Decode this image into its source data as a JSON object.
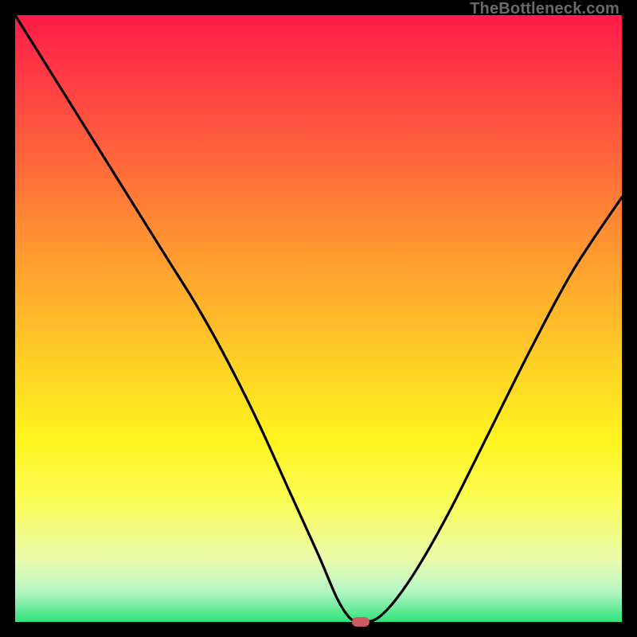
{
  "watermark": "TheBottleneck.com",
  "colors": {
    "page_bg": "#000000",
    "curve_stroke": "#000000",
    "marker_fill": "#cf5a63",
    "gradient_top": "#ff1b46",
    "gradient_bottom": "#2fe37a"
  },
  "chart_data": {
    "type": "line",
    "title": "",
    "xlabel": "",
    "ylabel": "",
    "xlim": [
      0,
      100
    ],
    "ylim": [
      0,
      100
    ],
    "grid": false,
    "legend": false,
    "annotations": [],
    "series": [
      {
        "name": "bottleneck-curve",
        "x": [
          0,
          5,
          10,
          15,
          20,
          25,
          30,
          35,
          40,
          45,
          50,
          53,
          55,
          56.5,
          58,
          60,
          63,
          67,
          72,
          78,
          85,
          92,
          100
        ],
        "values": [
          100,
          92,
          84,
          76,
          68,
          60,
          52,
          43,
          33,
          22,
          11,
          4,
          0.8,
          0,
          0,
          0.8,
          4,
          10,
          19,
          31,
          45,
          58,
          70
        ]
      }
    ],
    "marker": {
      "x": 57,
      "y": 0,
      "shape": "rounded-rect"
    }
  }
}
